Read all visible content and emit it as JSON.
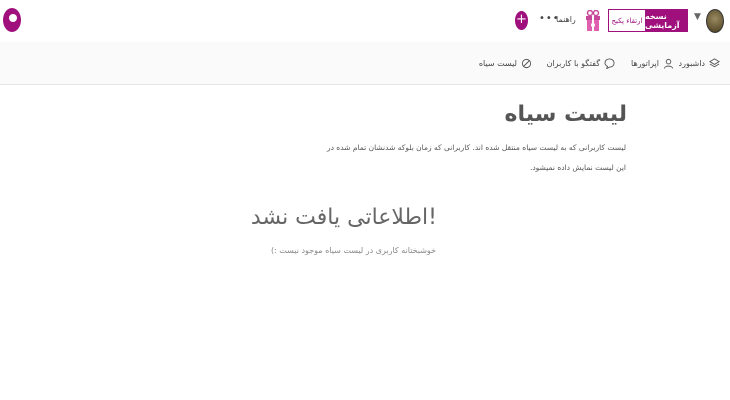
{
  "header": {
    "demo_badge": "نسخه آزمایشی",
    "upgrade_label": "ارتقاء پکیج",
    "help_label": "راهنما",
    "more_label": "•••",
    "add_label": "+"
  },
  "nav": {
    "items": [
      {
        "label": "داشبورد",
        "icon": "layers-icon"
      },
      {
        "label": "اپراتورها",
        "icon": "user-icon"
      },
      {
        "label": "گفتگو با کاربران",
        "icon": "chat-icon"
      },
      {
        "label": "لیست سیاه",
        "icon": "block-icon"
      }
    ]
  },
  "main": {
    "title": "لیست سیاه",
    "description": "لیست کاربرانی که به لیست سیاه منتقل شده اند. کاربرانی که زمان بلوکه شدنشان تمام شده در این لیست نمایش داده نمیشود.",
    "empty_title": "اطلاعاتی یافت نشد!",
    "empty_subtitle": "خوشبختانه کاربری در لیست سیاه موجود نیست :)"
  },
  "colors": {
    "brand": "#a0107d"
  }
}
